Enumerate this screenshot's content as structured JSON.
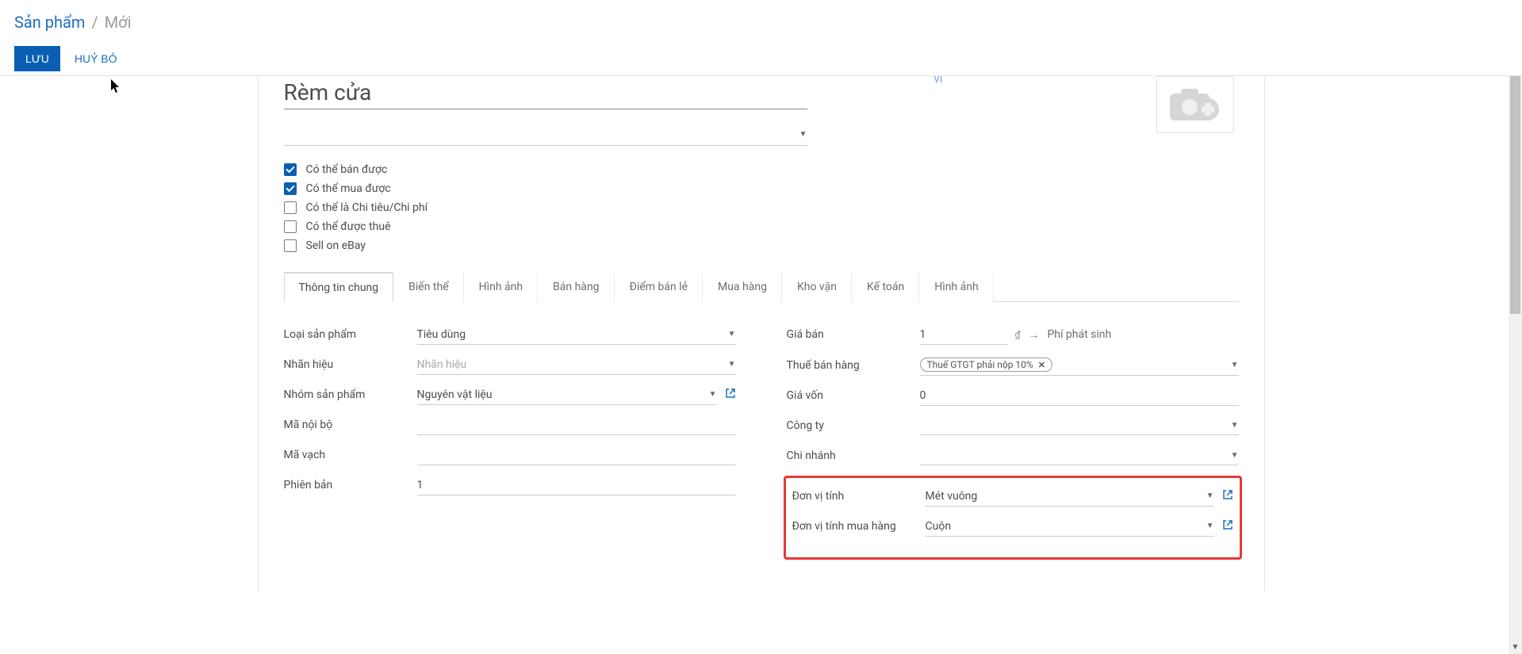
{
  "breadcrumb": {
    "root": "Sản phẩm",
    "separator": "/",
    "current": "Mới"
  },
  "actions": {
    "save": "LƯU",
    "discard": "HUỶ BỎ"
  },
  "product_name": "Rèm cửa",
  "lang_badge": "VI",
  "checkboxes": [
    {
      "label": "Có thể bán được",
      "checked": true
    },
    {
      "label": "Có thể mua được",
      "checked": true
    },
    {
      "label": "Có thể là Chi tiêu/Chi phí",
      "checked": false
    },
    {
      "label": "Có thể được thuê",
      "checked": false
    },
    {
      "label": "Sell on eBay",
      "checked": false
    }
  ],
  "tabs": [
    "Thông tin chung",
    "Biến thể",
    "Hình ảnh",
    "Bán hàng",
    "Điểm bán lẻ",
    "Mua hàng",
    "Kho vận",
    "Kế toán",
    "Hình ảnh"
  ],
  "active_tab": 0,
  "left_fields": {
    "product_type": {
      "label": "Loại sản phẩm",
      "value": "Tiêu dùng"
    },
    "brand": {
      "label": "Nhãn hiệu",
      "placeholder": "Nhãn hiệu"
    },
    "category": {
      "label": "Nhóm sản phẩm",
      "value": "Nguyên vật liệu"
    },
    "internal_ref": {
      "label": "Mã nội bộ",
      "value": ""
    },
    "barcode": {
      "label": "Mã vạch",
      "value": ""
    },
    "version": {
      "label": "Phiên bản",
      "value": "1"
    }
  },
  "right_fields": {
    "sale_price": {
      "label": "Giá bán",
      "value": "1",
      "currency": "₫",
      "extra": "Phí phát sinh"
    },
    "sale_tax": {
      "label": "Thuế bán hàng",
      "tag": "Thuế GTGT phải nộp 10%"
    },
    "cost": {
      "label": "Giá vốn",
      "value": "0"
    },
    "company": {
      "label": "Công ty",
      "value": ""
    },
    "branch": {
      "label": "Chi nhánh",
      "value": ""
    },
    "uom": {
      "label": "Đơn vị tính",
      "value": "Mét vuông"
    },
    "purchase_uom": {
      "label": "Đơn vị tính mua hàng",
      "value": "Cuộn"
    }
  }
}
